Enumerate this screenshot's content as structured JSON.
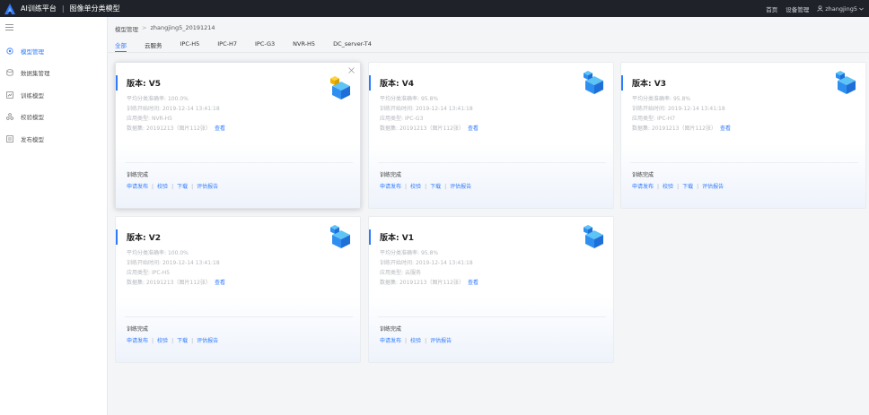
{
  "topbar": {
    "brand": "AI训练平台",
    "separator": "|",
    "subtitle": "图像单分类模型",
    "links": [
      "首页",
      "设备管理"
    ],
    "user": "zhangjing5",
    "logo_icon": "platform-logo-icon",
    "colors": {
      "bg": "#1f2329",
      "accent": "#2f7bff"
    }
  },
  "sidebar": {
    "toggle_icon": "menu-icon",
    "items": [
      {
        "label": "模型管理",
        "icon": "model-icon",
        "active": true
      },
      {
        "label": "数据集管理",
        "icon": "dataset-icon",
        "active": false
      },
      {
        "label": "训练模型",
        "icon": "train-icon",
        "active": false
      },
      {
        "label": "校验模型",
        "icon": "verify-icon",
        "active": false
      },
      {
        "label": "发布模型",
        "icon": "publish-icon",
        "active": false
      }
    ]
  },
  "breadcrumb": {
    "root": "模型管理",
    "sep": ">",
    "current": "zhangjing5_20191214"
  },
  "tabs": [
    "全部",
    "云服务",
    "IPC-H5",
    "IPC-H7",
    "IPC-G3",
    "NVR-H5",
    "DC_server-T4"
  ],
  "card_labels": {
    "accuracy": "平均分类准确率:",
    "start_time": "训练开始时间:",
    "app_type": "应用类型:",
    "dataset": "数据集:",
    "view": "查看",
    "status": "训练完成",
    "actions_full": [
      "申请发布",
      "校验",
      "下载",
      "评估报告"
    ],
    "actions_short": [
      "申请发布",
      "校验",
      "评估报告"
    ]
  },
  "cards": [
    {
      "version": "版本: V5",
      "accuracy": "100.0%",
      "start_time": "2019-12-14 13:41:18",
      "app_type": "NVR-H5",
      "dataset": "20191213（图片112张）",
      "status": "训练完成",
      "actions": "full",
      "selected": true
    },
    {
      "version": "版本: V4",
      "accuracy": "95.8%",
      "start_time": "2019-12-14 13:41:18",
      "app_type": "IPC-G3",
      "dataset": "20191213（图片112张）",
      "status": "训练完成",
      "actions": "full",
      "selected": false
    },
    {
      "version": "版本: V3",
      "accuracy": "95.8%",
      "start_time": "2019-12-14 13:41:18",
      "app_type": "IPC-H7",
      "dataset": "20191213（图片112张）",
      "status": "训练完成",
      "actions": "full",
      "selected": false
    },
    {
      "version": "版本: V2",
      "accuracy": "100.0%",
      "start_time": "2019-12-14 13:41:18",
      "app_type": "IPC-H5",
      "dataset": "20191213（图片112张）",
      "status": "训练完成",
      "actions": "full",
      "selected": false
    },
    {
      "version": "版本: V1",
      "accuracy": "95.8%",
      "start_time": "2019-12-14 13:41:18",
      "app_type": "云服务",
      "dataset": "20191213（图片112张）",
      "status": "训练完成",
      "actions": "short",
      "selected": false
    }
  ]
}
